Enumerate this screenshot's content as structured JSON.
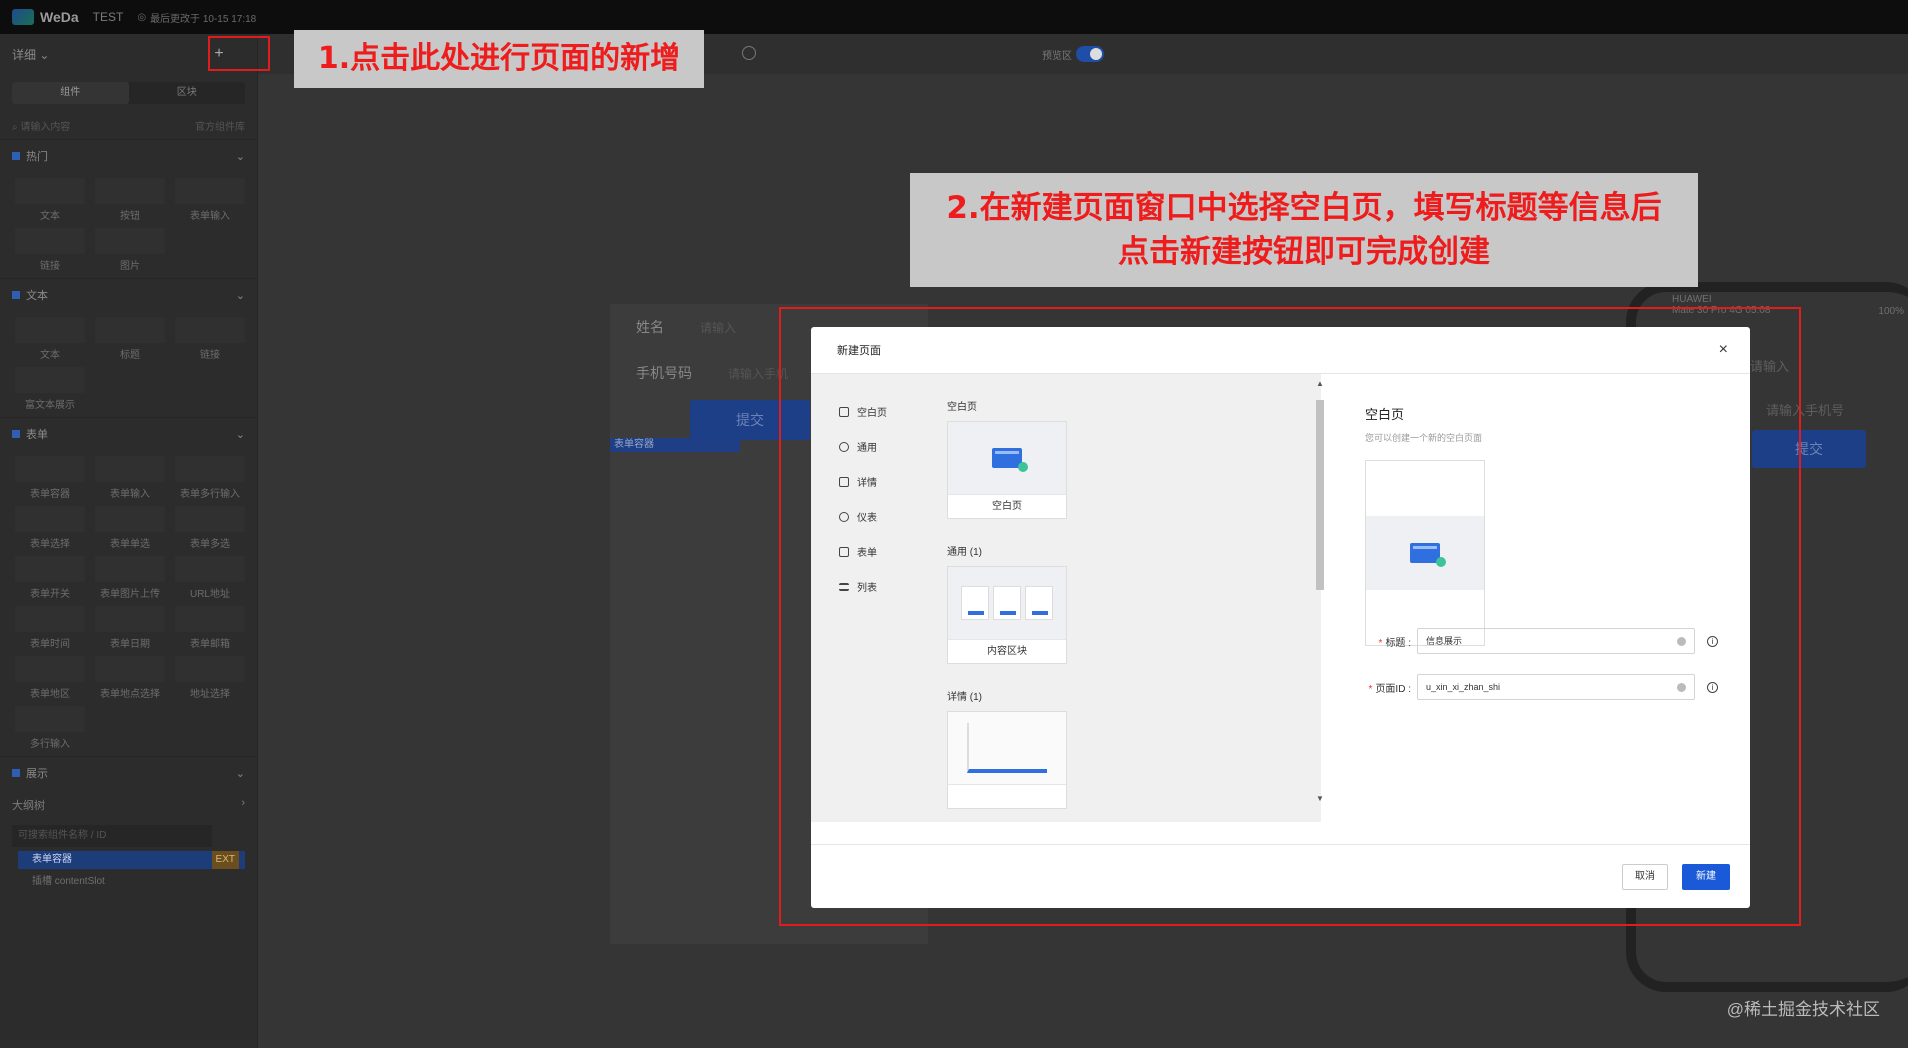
{
  "topbar": {
    "brand": "WeDa",
    "app_name": "TEST",
    "saved": "最后更改于 10-15 17:18"
  },
  "sidebar": {
    "page_select": "详细",
    "plus": "+",
    "tabs": [
      "组件",
      "区块"
    ],
    "search_placeholder": "请输入内容",
    "library": "官方组件库",
    "sections": [
      {
        "title": "热门",
        "items": [
          "文本",
          "按钮",
          "表单输入",
          "链接",
          "图片"
        ]
      },
      {
        "title": "文本",
        "items": [
          "文本",
          "标题",
          "链接",
          "富文本展示"
        ]
      },
      {
        "title": "表单",
        "items": [
          "表单容器",
          "表单输入",
          "表单多行输入",
          "表单选择",
          "表单单选",
          "表单多选",
          "表单开关",
          "表单图片上传",
          "URL地址",
          "表单时间",
          "表单日期",
          "表单邮箱",
          "表单地区",
          "表单地点选择",
          "地址选择",
          "多行输入"
        ]
      },
      {
        "title": "展示",
        "items": []
      }
    ],
    "outline": "大纲树",
    "tree_search_placeholder": "可搜索组件名称 / ID",
    "tree_items": [
      "表单容器",
      "插槽 contentSlot"
    ],
    "tree_badge": "EXT"
  },
  "toolbar": {
    "toggle_label": "预览区"
  },
  "mini_form": {
    "rows": [
      {
        "label": "姓名",
        "placeholder": "请输入"
      },
      {
        "label": "手机号码",
        "placeholder": "请输入手机"
      }
    ],
    "submit": "提交",
    "badge": "表单容器"
  },
  "phone": {
    "carrier": "HUAWEI",
    "model": "Mate 30 Pro",
    "network": "4G",
    "time": "05:08",
    "battery": "100%",
    "ph1": "请输入",
    "ph2": "请输入手机号",
    "submit": "提交"
  },
  "annotations": {
    "step1": "1.点击此处进行页面的新增",
    "step2_line1": "2.在新建页面窗口中选择空白页，填写标题等信息后",
    "step2_line2": "点击新建按钮即可完成创建"
  },
  "dialog": {
    "title": "新建页面",
    "close": "×",
    "categories": [
      "空白页",
      "通用",
      "详情",
      "仪表",
      "表单",
      "列表"
    ],
    "groups": [
      {
        "title": "空白页",
        "card": "空白页"
      },
      {
        "title": "通用 (1)",
        "card": "内容区块"
      },
      {
        "title": "详情 (1)",
        "card": ""
      }
    ],
    "preview_title": "空白页",
    "preview_desc": "您可以创建一个新的空白页面",
    "fields": [
      {
        "label": "标题",
        "value": "信息展示"
      },
      {
        "label": "页面ID",
        "value": "u_xin_xi_zhan_shi"
      }
    ],
    "cancel": "取消",
    "create": "新建"
  },
  "watermark": "@稀土掘金技术社区"
}
